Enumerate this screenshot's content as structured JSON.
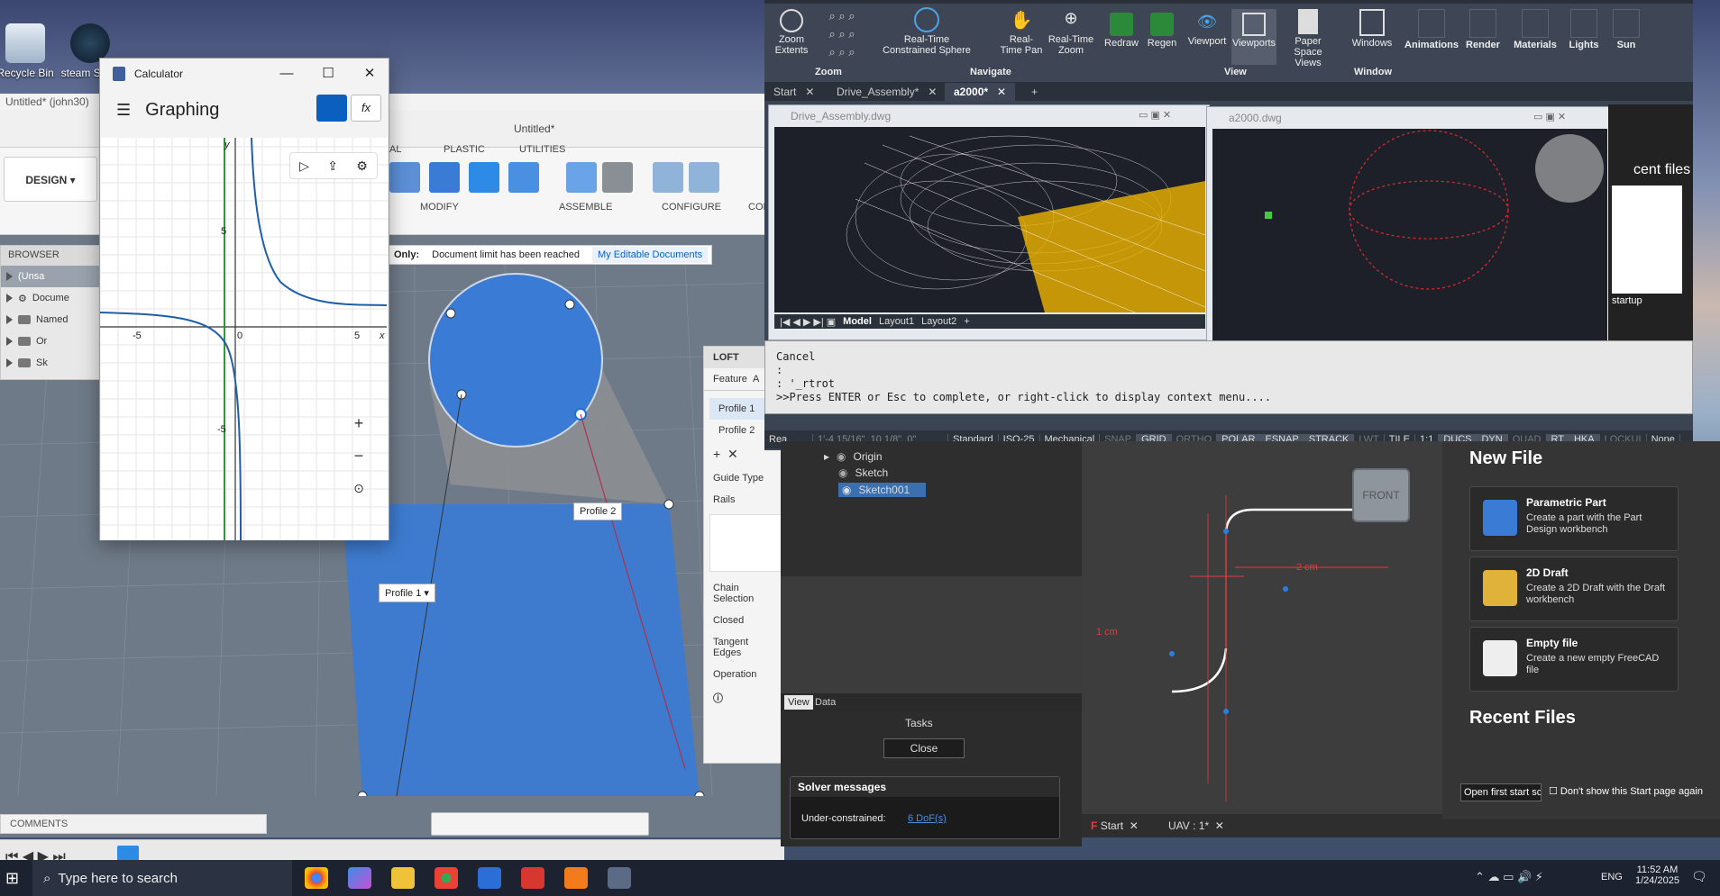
{
  "desktop": {
    "icons": [
      {
        "label": "Recycle Bin"
      },
      {
        "label": "steam Short"
      }
    ]
  },
  "fusion": {
    "doc_tab": "Untitled* (john30)",
    "doc_title": "Untitled*",
    "design_btn": "DESIGN",
    "ribbon_tabs": [
      "AL",
      "PLASTIC",
      "UTILITIES"
    ],
    "ribbon_groups": [
      "MODIFY",
      "ASSEMBLE",
      "CONFIGURE",
      "CONST"
    ],
    "notice": "Document limit has been reached",
    "notice_prefix": "Only:",
    "editable_link": "My Editable Documents",
    "browser_title": "BROWSER",
    "browser_items": [
      "(Unsa",
      "Docume",
      "Named",
      "Or",
      "Sk"
    ],
    "comments": "COMMENTS",
    "profile_labels": [
      "Profile 1",
      "Profile 2"
    ],
    "loft": {
      "title": "LOFT",
      "tab1": "Feature",
      "tab2": "A",
      "profiles": [
        "Profile 1",
        "Profile 2"
      ],
      "fields": [
        "Guide Type",
        "Rails",
        "Chain Selection",
        "Closed",
        "Tangent Edges",
        "Operation"
      ]
    }
  },
  "calculator": {
    "app_title": "Calculator",
    "mode": "Graphing",
    "fx": "fx",
    "axis": {
      "x": "x",
      "y": "y",
      "xticks": [
        "-5",
        "0",
        "5"
      ],
      "yticks": [
        "5",
        "-5"
      ]
    },
    "zoom": [
      "+",
      "−",
      "⊙"
    ]
  },
  "autocad": {
    "ribbon": [
      {
        "label": "Zoom Extents"
      },
      {
        "label": "Real-Time Constrained Sphere"
      },
      {
        "label": "Real-Time Pan"
      },
      {
        "label": "Real-Time Zoom"
      },
      {
        "label": "Redraw"
      },
      {
        "label": "Regen"
      },
      {
        "label": "Viewport"
      },
      {
        "label": "Viewports"
      },
      {
        "label": "Paper Space Views"
      },
      {
        "label": "Windows"
      },
      {
        "label": "Animations"
      },
      {
        "label": "Render"
      },
      {
        "label": "Materials"
      },
      {
        "label": "Lights"
      },
      {
        "label": "Sun"
      }
    ],
    "groups": [
      "Zoom",
      "Navigate",
      "View",
      "Window"
    ],
    "tabs": [
      "Start",
      "Drive_Assembly*",
      "a2000*"
    ],
    "drawings": [
      "Drive_Assembly.dwg",
      "a2000.dwg"
    ],
    "layout_tabs": [
      "Model",
      "Layout1",
      "Layout2"
    ],
    "recent_files": "cent files",
    "startup": "startup",
    "cmd_lines": [
      "Cancel",
      ":",
      ": '_rtrot",
      ">>Press ENTER or Esc to complete, or right-click to display context menu...."
    ],
    "status": [
      "Rea",
      "1'-4 15/16\", 10 1/8\", 0\"",
      "Standard",
      "ISO-25",
      "Mechanical",
      "SNAP",
      "GRID",
      "ORTHO",
      "POLAR",
      "ESNAP",
      "STRACK",
      "LWT",
      "TILE",
      "1:1",
      "DUCS",
      "DYN",
      "QUAD",
      "RT",
      "HKA",
      "LOCKUI",
      "None"
    ]
  },
  "freecad": {
    "tree": [
      "Origin",
      "Sketch",
      "Sketch001"
    ],
    "panel_tabs": [
      "View",
      "Data"
    ],
    "tasks_title": "Tasks",
    "close_btn": "Close",
    "solver_title": "Solver messages",
    "solver_msg": "Under-constrained:",
    "dof_link": "6 DoF(s)",
    "nav_cube": "FRONT",
    "dims": [
      "2 cm",
      "1 cm"
    ],
    "new_file_title": "New File",
    "recent_title": "Recent Files",
    "cards": [
      {
        "title": "Parametric Part",
        "desc": "Create a part with the Part Design workbench"
      },
      {
        "title": "2D Draft",
        "desc": "Create a 2D Draft with the Draft workbench"
      },
      {
        "title": "Empty file",
        "desc": "Create a new empty FreeCAD file"
      }
    ],
    "open_first": "Open first start sc",
    "dont_show": "Don't show this Start page again",
    "doc_tabs": [
      "Start",
      "UAV : 1*"
    ]
  },
  "taskbar": {
    "search": "Type here to search",
    "time": "11:52 AM",
    "date": "1/24/2025",
    "lang": "ENG"
  },
  "colors": {
    "accent": "#0a5fbf",
    "loft_blue": "#3a7bd5",
    "acad_yellow": "#f0b400",
    "dim_red": "#e23b3b"
  }
}
